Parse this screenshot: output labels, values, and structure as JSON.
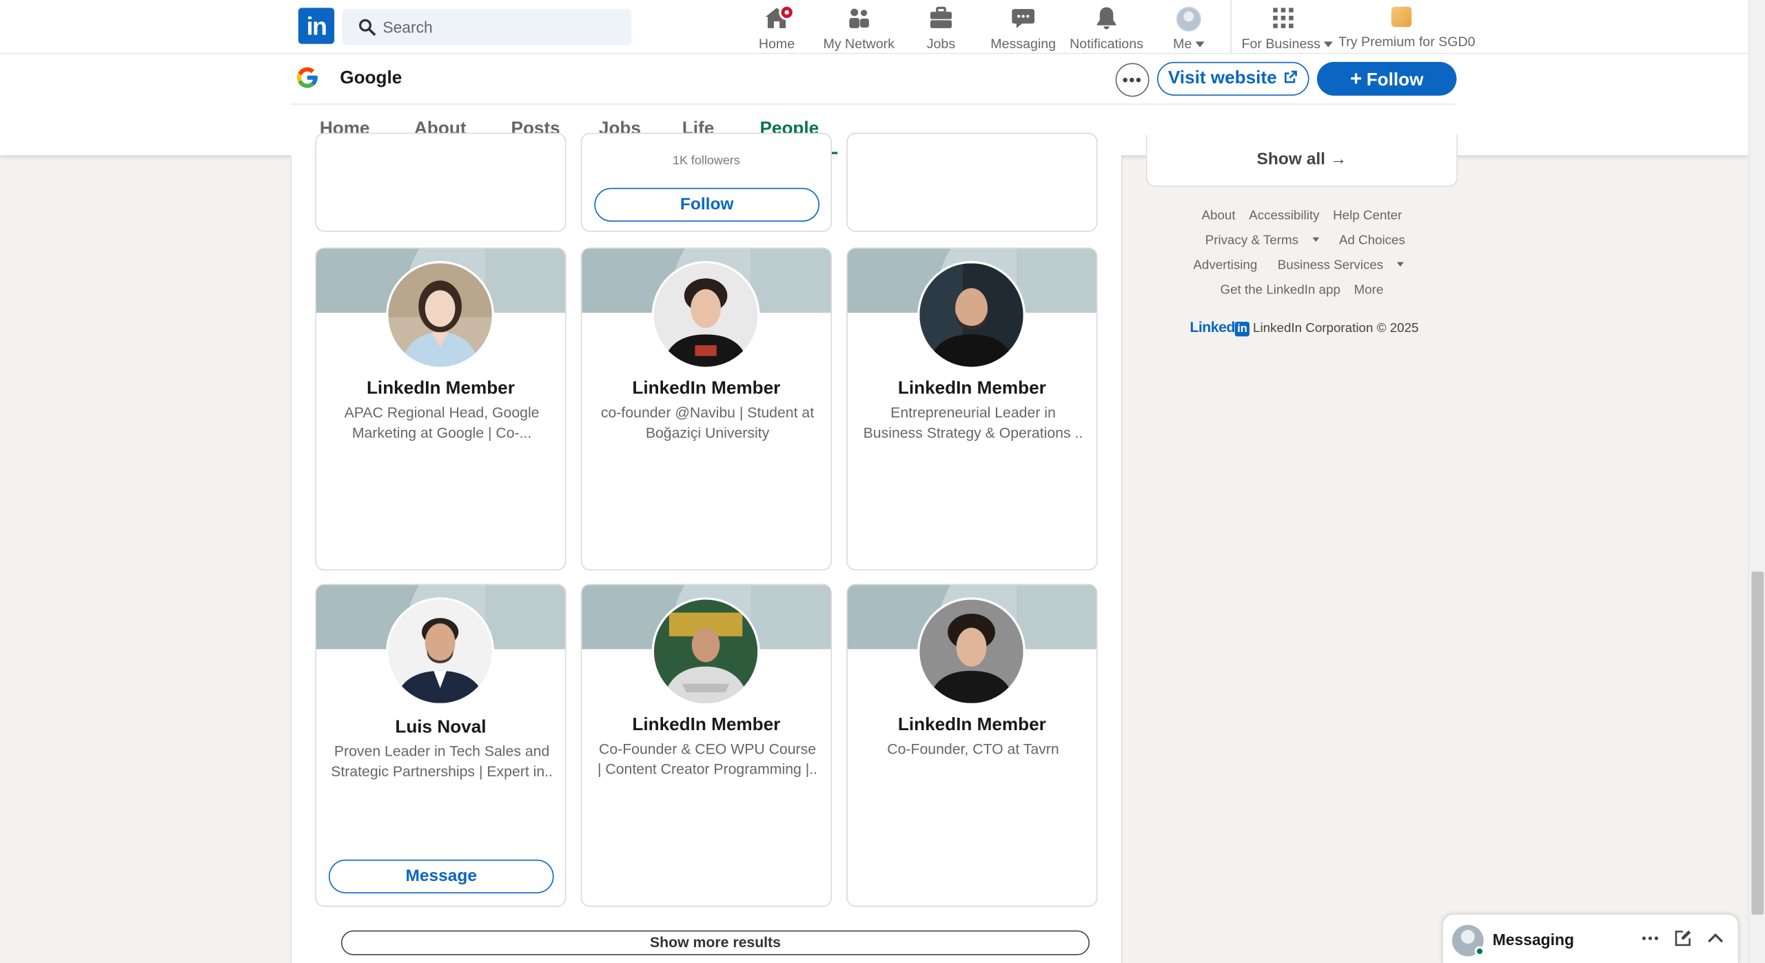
{
  "nav": {
    "logo_text": "in",
    "search_placeholder": "Search",
    "items": [
      {
        "label": "Home",
        "icon": "home-icon",
        "badge": true
      },
      {
        "label": "My Network",
        "icon": "people-icon"
      },
      {
        "label": "Jobs",
        "icon": "briefcase-icon"
      },
      {
        "label": "Messaging",
        "icon": "chat-icon"
      },
      {
        "label": "Notifications",
        "icon": "bell-icon"
      },
      {
        "label": "Me",
        "icon": "avatar"
      },
      {
        "label": "For Business",
        "icon": "grid-icon"
      },
      {
        "label": "Try Premium for SGD0",
        "icon": "premium-icon"
      }
    ]
  },
  "company": {
    "name": "Google",
    "more_label": "•••",
    "visit_label": "Visit website",
    "follow_label": "Follow",
    "tabs": [
      "Home",
      "About",
      "Posts",
      "Jobs",
      "Life",
      "People"
    ],
    "active_tab": "People"
  },
  "people": {
    "partial_row": {
      "followers": "1K followers",
      "follow_label": "Follow"
    },
    "cards": [
      {
        "name": "LinkedIn Member",
        "headline": "APAC Regional Head, Google Marketing at Google | Co-...",
        "button": ""
      },
      {
        "name": "LinkedIn Member",
        "headline": "co-founder @Navibu | Student at Boğaziçi University",
        "button": ""
      },
      {
        "name": "LinkedIn Member",
        "headline": "Entrepreneurial Leader in Business Strategy & Operations ..",
        "button": ""
      },
      {
        "name": "Luis Noval",
        "headline": "Proven Leader in Tech Sales and Strategic Partnerships | Expert in..",
        "button": "Message"
      },
      {
        "name": "LinkedIn Member",
        "headline": "Co-Founder & CEO WPU Course | Content Creator Programming |..",
        "button": ""
      },
      {
        "name": "LinkedIn Member",
        "headline": "Co-Founder, CTO at Tavrn",
        "button": ""
      }
    ],
    "show_more": "Show more results"
  },
  "rail": {
    "show_all": "Show all",
    "footer_rows": [
      [
        "About",
        "Accessibility",
        "Help Center"
      ],
      [
        "Privacy & Terms",
        "Ad Choices"
      ],
      [
        "Advertising",
        "Business Services"
      ],
      [
        "Get the LinkedIn app",
        "More"
      ]
    ],
    "copyright_brand": "Linked",
    "copyright_text": "LinkedIn Corporation © 2025"
  },
  "messaging": {
    "label": "Messaging"
  },
  "colors": {
    "brand": "#0a66c2",
    "active_tab": "#01754f",
    "page_bg": "#f4f2ee"
  }
}
